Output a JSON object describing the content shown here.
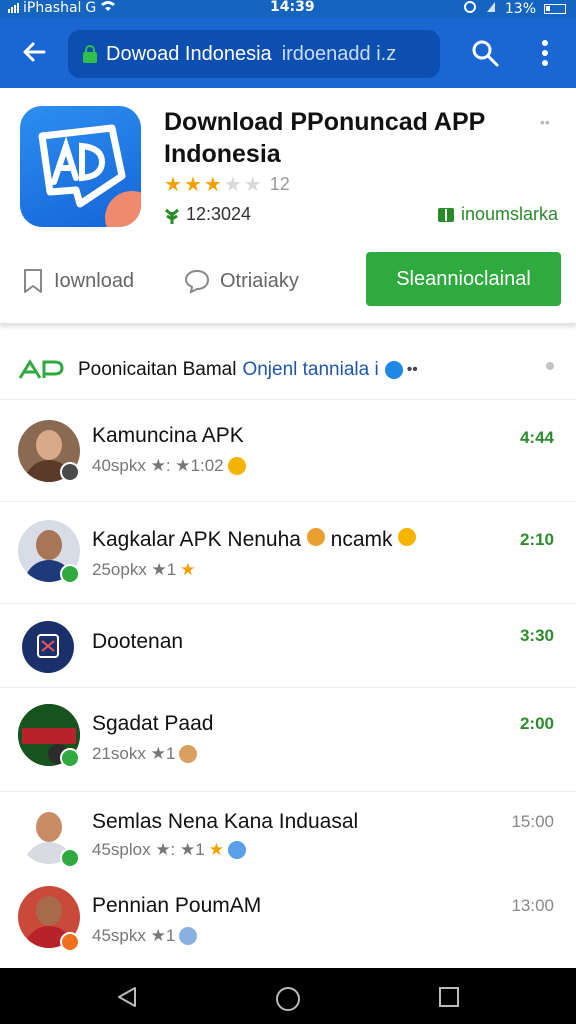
{
  "status_bar": {
    "carrier": "iPhashal",
    "network": "G",
    "time": "14:39",
    "battery": "13%"
  },
  "toolbar": {
    "url_text": "Dowoad Indonesia",
    "url_sub": "irdoenadd i.z"
  },
  "app": {
    "title": "Download PPonuncad APP Indonesia",
    "rating_stars": 3,
    "rating_count": "12",
    "downloads": "12:3024",
    "developer": "inoumslarka",
    "action_download": "Iownload",
    "action_share": "Otriaiaky",
    "install_label": "Sleannioclainal"
  },
  "section": {
    "title": "Poonicaitan Bamal",
    "subtitle": "Onjenl tanniala i"
  },
  "list": [
    {
      "name": "Kamuncina APK",
      "meta": "40spkx ★: ★1:02",
      "time": "4:44",
      "time_style": "green"
    },
    {
      "name": "Kagkalar APK Nenuha",
      "name_extra": "ncamk",
      "meta": "25opkx ★1",
      "time": "2:10",
      "time_style": "green"
    },
    {
      "name": "Dootenan",
      "meta": "",
      "time": "3:30",
      "time_style": "green"
    },
    {
      "name": "Sgadat Paad",
      "meta": "21sokx ★1",
      "time": "2:00",
      "time_style": "green"
    },
    {
      "name": "Semlas Nena Kana Induasal",
      "meta": "45splox ★: ★1",
      "time": "15:00",
      "time_style": "gray"
    },
    {
      "name": "Pennian PoumAM",
      "meta": "45spkx ★1",
      "time": "13:00",
      "time_style": "gray"
    }
  ],
  "colors": {
    "appbar": "#1a66d2",
    "install": "#2eaa3f",
    "time_green": "#2e8b2e"
  }
}
